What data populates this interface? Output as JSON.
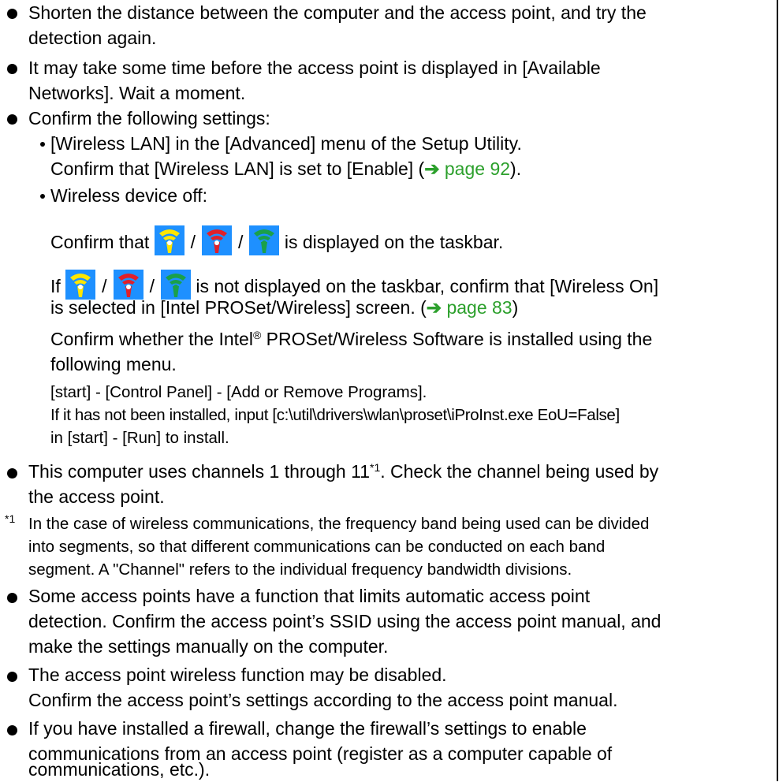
{
  "items": {
    "b1_l1": "Shorten the distance between the computer and the access point, and try the",
    "b1_l2": "detection again.",
    "b2_l1": "It may take some time before the access point is displayed in [Available",
    "b2_l2": "Networks]. Wait a moment.",
    "b3_l1": "Confirm the following settings:",
    "s1_l1": "[Wireless LAN] in the [Advanced] menu of the Setup Utility.",
    "s1_l2_pre": "Confirm that [Wireless LAN] is set to [Enable] (",
    "s1_l2_link": "page 92",
    "s1_l2_post": ").",
    "s2_l1": "Wireless device off:",
    "s2_l2_pre": "Confirm that",
    "s2_l2_post": "is displayed on the taskbar.",
    "s2_l3_pre": "If",
    "s2_l3_post": "is not displayed on the taskbar, confirm that [Wireless On]",
    "s2_l4_pre": "is selected in [Intel PROSet/Wireless] screen. (",
    "s2_l4_link": "page 83",
    "s2_l4_post": ")",
    "s2_l5_pre": "Confirm whether the Intel",
    "s2_l5_sup": "®",
    "s2_l5_post": " PROSet/Wireless Software is installed using the",
    "s2_l6": "following menu.",
    "s2_l7": "[start] - [Control Panel] - [Add or Remove Programs].",
    "s2_l8": "If it has not been installed, input [c:\\util\\drivers\\wlan\\proset\\iProInst.exe EoU=False]",
    "s2_l9": "in [start] - [Run] to install.",
    "b4_l1_pre": "This computer uses channels 1 through 11",
    "b4_l1_sup": "*1",
    "b4_l1_post": ". Check the channel being used by",
    "b4_l2": "the access point.",
    "fn_mark": "*1",
    "fn_l1": "In the case of wireless communications, the frequency band being used can be divided",
    "fn_l2": "into segments, so that different communications can be conducted on each band",
    "fn_l3": "segment.  A \"Channel\" refers to the individual frequency bandwidth divisions.",
    "b5_l1": "Some access points have a function that limits automatic access point",
    "b5_l2": "detection. Confirm the access point’s SSID using the access point manual, and",
    "b5_l3": "make the settings manually on the computer.",
    "b6_l1": "The access point wireless function may be disabled.",
    "b6_l2": "Confirm the access point’s settings according to the access point manual.",
    "b7_l1": "If you have installed a firewall, change the firewall’s settings to enable",
    "b7_l2": "communications from an access point (register as a computer capable of",
    "b7_l3": "communications, etc.)."
  },
  "icons": [
    "wireless-yellow-icon",
    "wireless-red-icon",
    "wireless-green-icon"
  ],
  "colors": {
    "link": "#2ca02c",
    "icon_bg": "#1e90ff",
    "yellow": "#ffe600",
    "red": "#e0202a",
    "green": "#1aa04a"
  }
}
